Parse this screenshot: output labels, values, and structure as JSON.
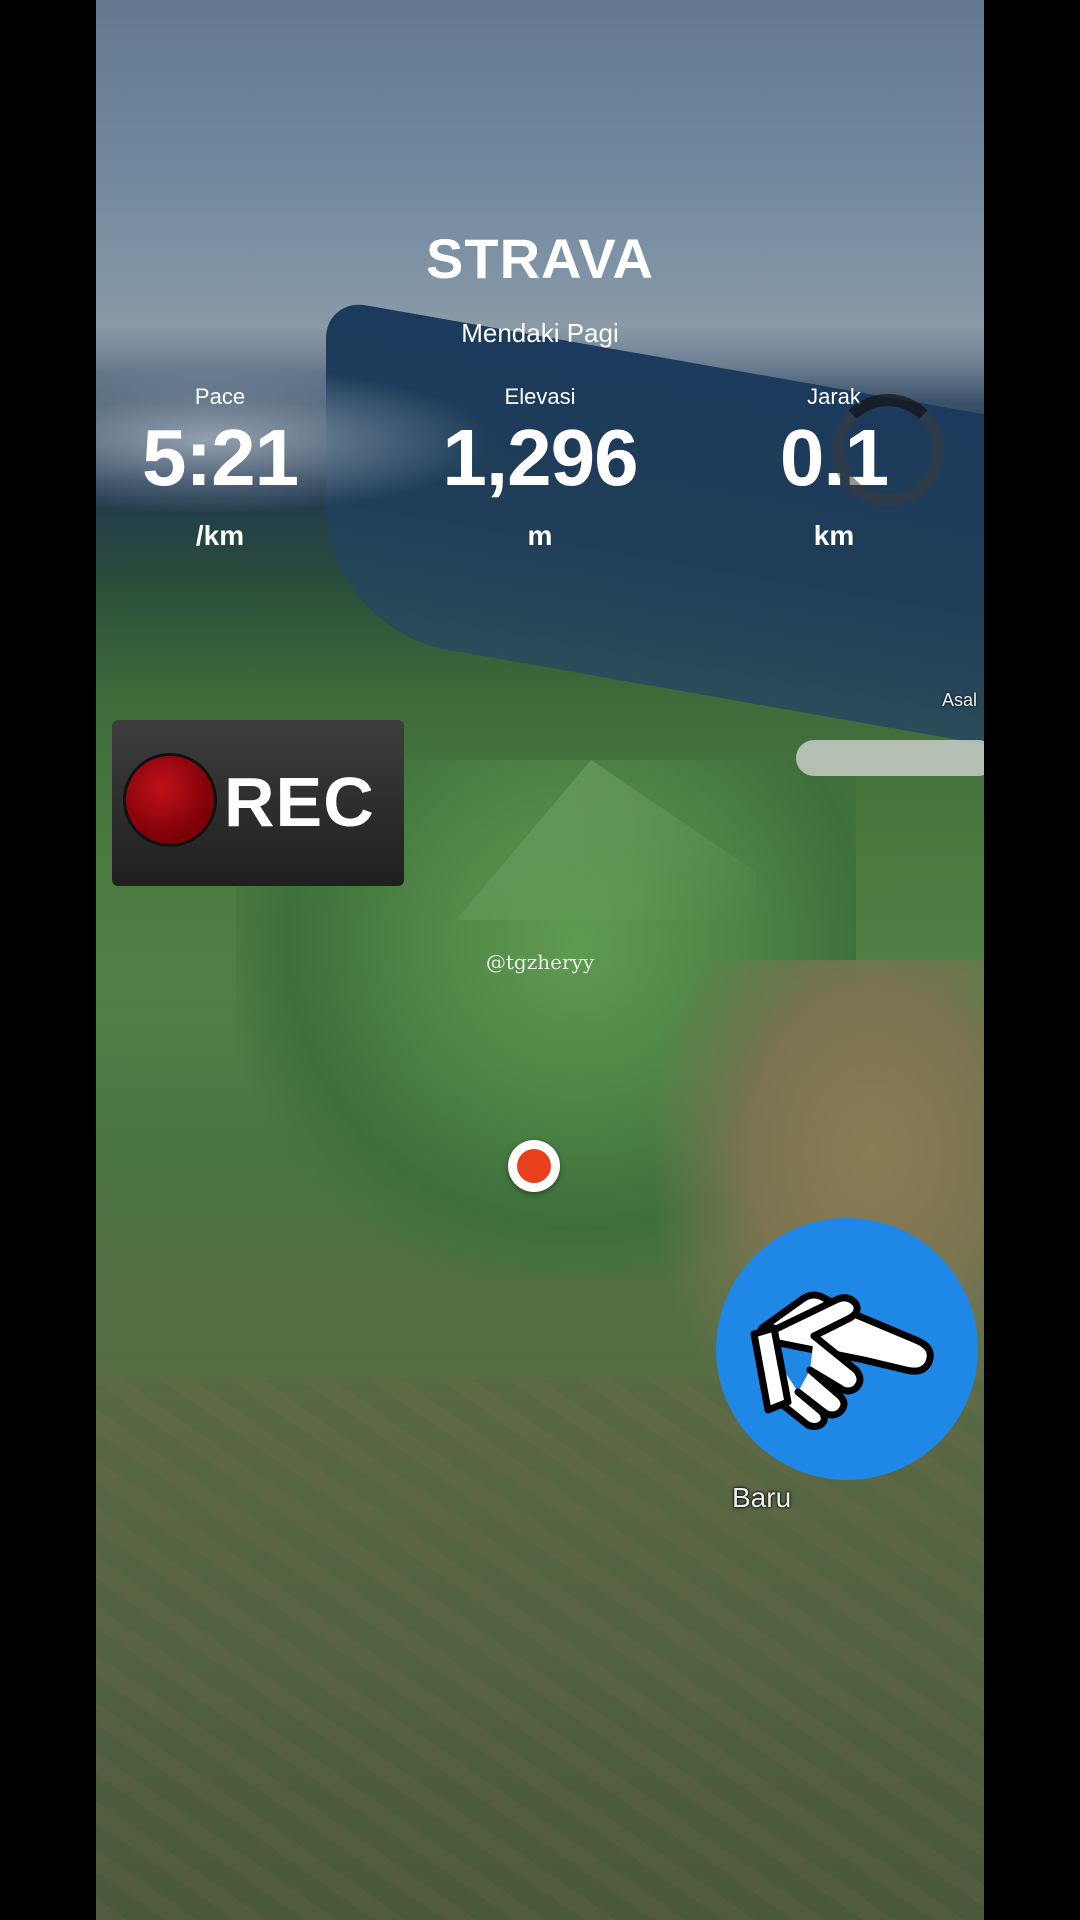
{
  "brand": {
    "logo_text": "STRAVA"
  },
  "activity": {
    "title": "Mendaki Pagi"
  },
  "stats": [
    {
      "label": "Pace",
      "value": "5:21",
      "unit": "/km"
    },
    {
      "label": "Elevasi",
      "value": "1,296",
      "unit": "m"
    },
    {
      "label": "Jarak",
      "value": "0.1",
      "unit": "km"
    }
  ],
  "map": {
    "labels": {
      "asal": "Asal",
      "baru": "Baru"
    },
    "watermark": "@tgzheryy"
  },
  "overlay": {
    "rec_label": "REC",
    "pointer_icon": "pointing-hand-icon",
    "pointer_color": "#1f87e5",
    "rec_color": "#a00810"
  },
  "loading_icon": "spinner-icon"
}
